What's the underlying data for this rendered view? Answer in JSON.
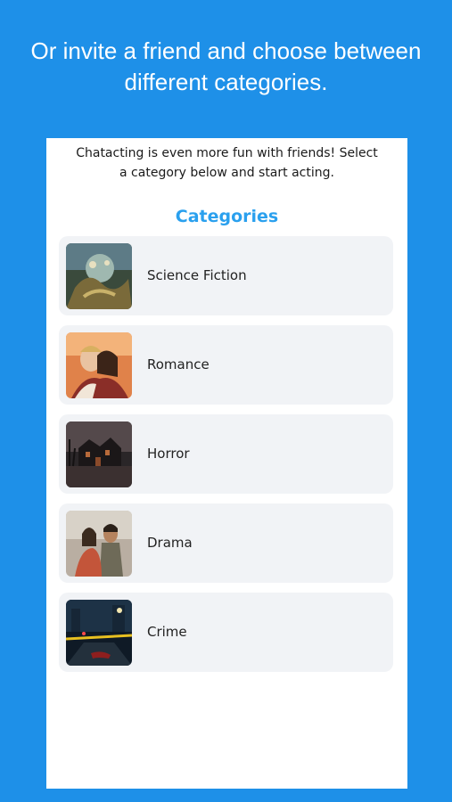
{
  "promo": {
    "headline_line1": "Or invite a friend and choose between",
    "headline_line2": "different categories."
  },
  "screen": {
    "intro_line1": "Chatacting is even more fun with friends! Select",
    "intro_line2": "a category below and start acting.",
    "categories_title": "Categories",
    "categories": [
      {
        "label": "Science Fiction",
        "image": "sci-fi-creature-artwork"
      },
      {
        "label": "Romance",
        "image": "embracing-couple-photo"
      },
      {
        "label": "Horror",
        "image": "haunted-house-photo"
      },
      {
        "label": "Drama",
        "image": "seated-couple-photo"
      },
      {
        "label": "Crime",
        "image": "crime-scene-street-photo"
      }
    ]
  },
  "colors": {
    "background": "#1e90e8",
    "accent": "#2aa0ee",
    "card": "#f1f3f6"
  }
}
